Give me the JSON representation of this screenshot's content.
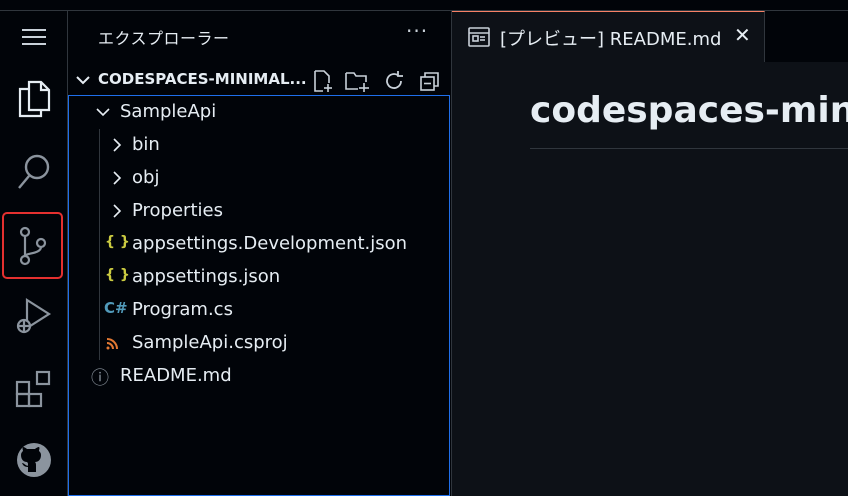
{
  "sidebar": {
    "title": "エクスプローラー",
    "more": "···",
    "section_title": "CODESPACES-MINIMAL...",
    "tree": [
      {
        "label": "SampleApi",
        "kind": "folder-open",
        "icon": "chevron-down-icon"
      },
      {
        "label": "bin",
        "kind": "folder",
        "icon": "chevron-right-icon"
      },
      {
        "label": "obj",
        "kind": "folder",
        "icon": "chevron-right-icon"
      },
      {
        "label": "Properties",
        "kind": "folder",
        "icon": "chevron-right-icon"
      },
      {
        "label": "appsettings.Development.json",
        "kind": "file",
        "icon": "json-file-icon",
        "glyph": "{ }"
      },
      {
        "label": "appsettings.json",
        "kind": "file",
        "icon": "json-file-icon",
        "glyph": "{ }"
      },
      {
        "label": "Program.cs",
        "kind": "file",
        "icon": "csharp-file-icon",
        "glyph": "C#"
      },
      {
        "label": "SampleApi.csproj",
        "kind": "file",
        "icon": "rss-file-icon"
      },
      {
        "label": "README.md",
        "kind": "file",
        "icon": "info-icon",
        "glyph": "ⓘ"
      }
    ]
  },
  "editor": {
    "tab_label": "[プレビュー] README.md",
    "tab_close": "✕",
    "preview_heading": "codespaces-mini"
  },
  "colors": {
    "accent_tab_border": "#f78166",
    "selection_outline": "#e5302f",
    "focus_border": "#1f6feb",
    "json_icon": "#cbcb41",
    "csharp_icon": "#519aba",
    "rss_icon": "#e37933"
  }
}
